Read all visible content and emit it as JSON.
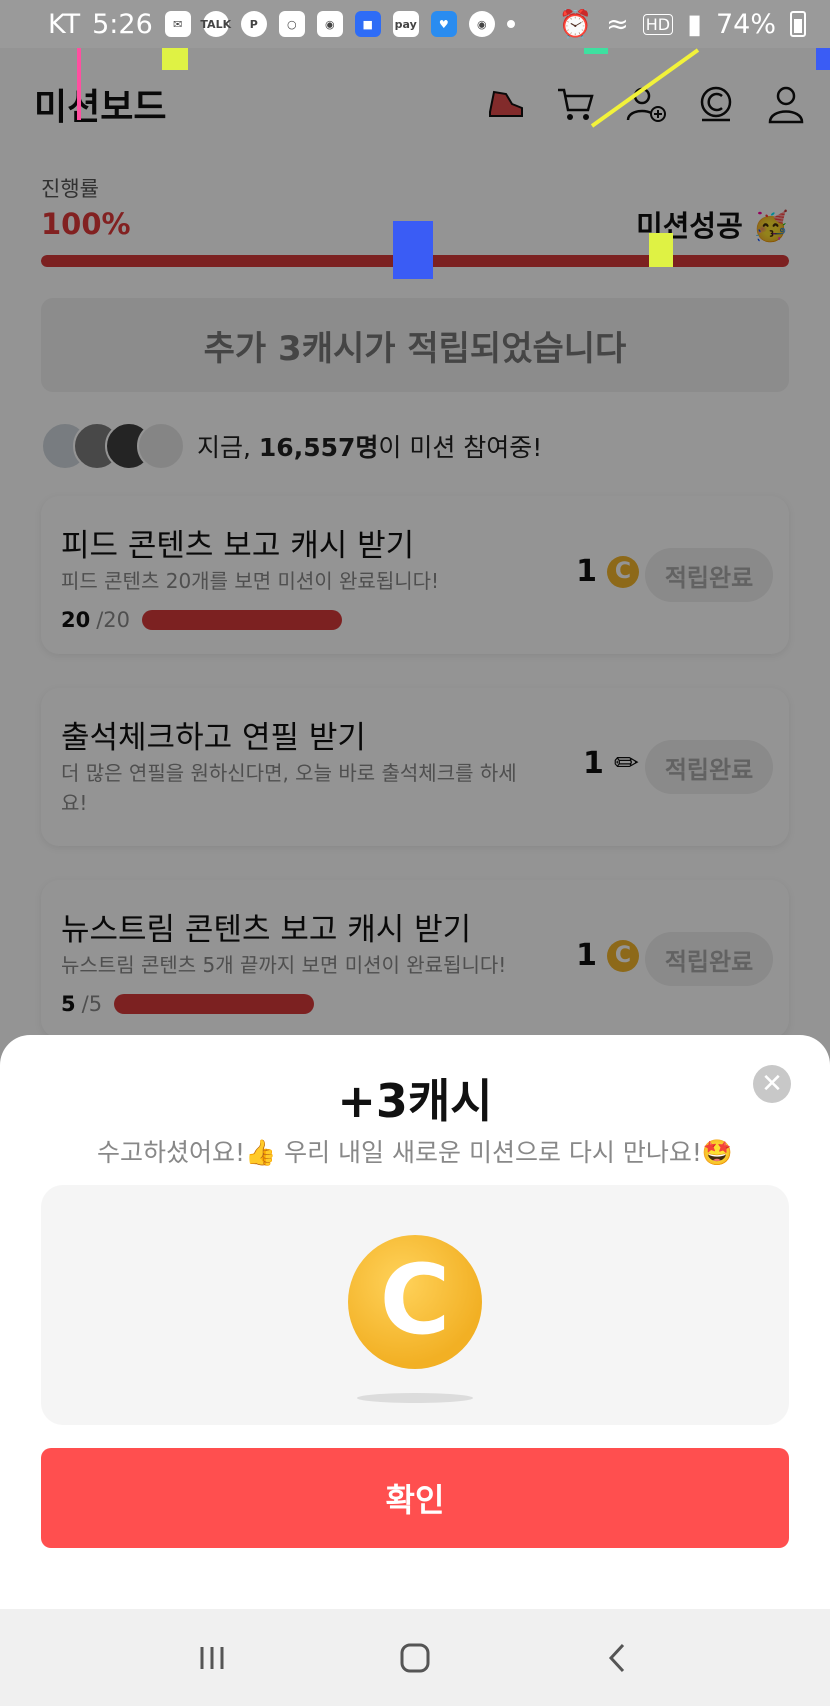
{
  "status_bar": {
    "carrier": "KT",
    "time": "5:26",
    "notif_icons": [
      "message-icon",
      "talk-icon",
      "p-icon",
      "instagram-icon",
      "discord-icon",
      "app-icon",
      "pay-icon",
      "heart-icon",
      "owl-icon"
    ],
    "talk_label": "TALK",
    "pay_label": "pay",
    "battery": "74%"
  },
  "header": {
    "title": "미션보드",
    "icons": [
      "shoe-icon",
      "cart-icon",
      "add-friend-icon",
      "cash-icon",
      "profile-icon"
    ]
  },
  "progress": {
    "label": "진행률",
    "percent_text": "100%",
    "value": 1.0,
    "status": "미션성공 🥳"
  },
  "banner": {
    "text": "추가 3캐시가 적립되었습니다"
  },
  "participants": {
    "prefix": "지금, ",
    "count": "16,557명",
    "suffix": "이 미션 참여중!"
  },
  "missions": [
    {
      "title": "피드 콘텐츠 보고 캐시 받기",
      "desc": "피드 콘텐츠 20개를 보면 미션이 완료됩니다!",
      "done": "20",
      "total": "/20",
      "reward": "1",
      "reward_icon": "coin-icon",
      "button": "적립완료"
    },
    {
      "title": "출석체크하고 연필 받기",
      "desc": "더 많은 연필을 원하신다면, 오늘 바로 출석체크를 하세요!",
      "reward": "1",
      "reward_icon": "pencil-icon",
      "button": "적립완료"
    },
    {
      "title": "뉴스트림 콘텐츠 보고 캐시 받기",
      "desc": "뉴스트림 콘텐츠 5개 끝까지 보면 미션이 완료됩니다!",
      "done": "5",
      "total": "/5",
      "reward": "1",
      "reward_icon": "coin-icon",
      "button": "적립완료"
    }
  ],
  "sheet": {
    "title": "+3캐시",
    "subtitle": "수고하셨어요!👍 우리 내일 새로운 미션으로 다시 만나요!🤩",
    "coin_letter": "C",
    "confirm": "확인"
  },
  "colors": {
    "accent": "#ff4f4f",
    "progress": "#d63a3a",
    "coin": "#f2b024"
  }
}
